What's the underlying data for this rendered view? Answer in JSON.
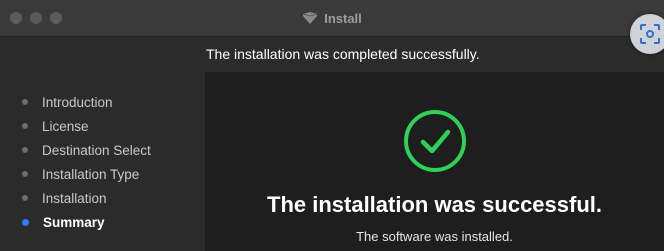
{
  "window": {
    "title": "Install",
    "title_icon": "package-icon"
  },
  "header": {
    "message": "The installation was completed successfully."
  },
  "sidebar": {
    "steps": [
      {
        "label": "Introduction",
        "active": false
      },
      {
        "label": "License",
        "active": false
      },
      {
        "label": "Destination Select",
        "active": false
      },
      {
        "label": "Installation Type",
        "active": false
      },
      {
        "label": "Installation",
        "active": false
      },
      {
        "label": "Summary",
        "active": true
      }
    ]
  },
  "main": {
    "status_icon": "checkmark-circle-icon",
    "title": "The installation was successful.",
    "subtitle": "The software was installed."
  },
  "colors": {
    "accent": "#2f7cf6",
    "success": "#2fd158"
  }
}
